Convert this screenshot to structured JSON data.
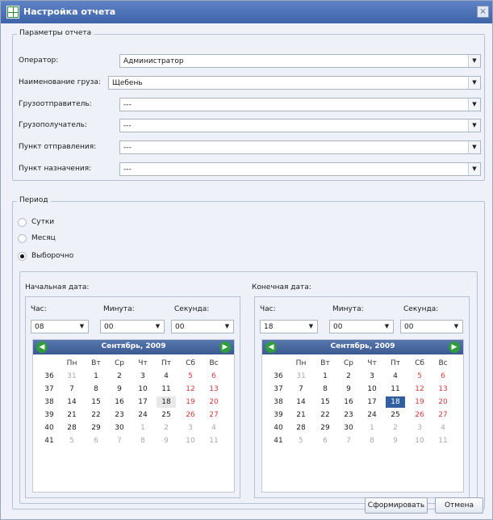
{
  "window": {
    "title": "Настройка отчета",
    "close_glyph": "×"
  },
  "params": {
    "legend": "Параметры отчета",
    "rows": [
      {
        "label": "Оператор:",
        "value": "Администратор"
      },
      {
        "label": "Наименование груза:",
        "value": "Щебень"
      },
      {
        "label": "Грузоотправитель:",
        "value": "---"
      },
      {
        "label": "Грузополучатель:",
        "value": "---"
      },
      {
        "label": "Пункт отправления:",
        "value": "---"
      },
      {
        "label": "Пункт назначения:",
        "value": "---"
      }
    ]
  },
  "period": {
    "legend": "Период",
    "options": [
      {
        "label": "Сутки",
        "checked": false
      },
      {
        "label": "Месяц",
        "checked": false
      },
      {
        "label": "Выборочно",
        "checked": true
      }
    ]
  },
  "dates": {
    "start": {
      "label": "Начальная дата:",
      "hour_label": "Час:",
      "minute_label": "Минута:",
      "second_label": "Секунда:",
      "hour": "08",
      "minute": "00",
      "second": "00",
      "calendar": {
        "title": "Сентябрь, 2009",
        "prev": "◀",
        "next": "▶",
        "highlight_day": "18",
        "highlight_style": "today"
      }
    },
    "end": {
      "label": "Конечная дата:",
      "hour_label": "Час:",
      "minute_label": "Минута:",
      "second_label": "Секунда:",
      "hour": "18",
      "minute": "00",
      "second": "00",
      "calendar": {
        "title": "Сентябрь, 2009",
        "prev": "◀",
        "next": "▶",
        "highlight_day": "18",
        "highlight_style": "selected"
      }
    },
    "weekdays": [
      "Пн",
      "Вт",
      "Ср",
      "Чт",
      "Пт",
      "Сб",
      "Вс"
    ],
    "weeks": [
      {
        "num": "36",
        "days": [
          "31",
          "1",
          "2",
          "3",
          "4",
          "5",
          "6"
        ]
      },
      {
        "num": "37",
        "days": [
          "7",
          "8",
          "9",
          "10",
          "11",
          "12",
          "13"
        ]
      },
      {
        "num": "38",
        "days": [
          "14",
          "15",
          "16",
          "17",
          "18",
          "19",
          "20"
        ]
      },
      {
        "num": "39",
        "days": [
          "21",
          "22",
          "23",
          "24",
          "25",
          "26",
          "27"
        ]
      },
      {
        "num": "40",
        "days": [
          "28",
          "29",
          "30",
          "1",
          "2",
          "3",
          "4"
        ]
      },
      {
        "num": "41",
        "days": [
          "5",
          "6",
          "7",
          "8",
          "9",
          "10",
          "11"
        ]
      }
    ],
    "muted_cells": {
      "36": [
        0
      ],
      "40": [
        3,
        4,
        5,
        6
      ],
      "41": [
        0,
        1,
        2,
        3,
        4,
        5,
        6
      ]
    }
  },
  "buttons": {
    "generate": "Сформировать",
    "cancel": "Отмена"
  },
  "colors": {
    "accent": "#3d63aa",
    "weekend": "#d63a3a",
    "selected": "#315f9f",
    "nav": "#2f9d3a"
  },
  "icons": {
    "app": "report-settings-icon",
    "dropdown": "chevron-down-icon",
    "prev": "arrow-left-icon",
    "next": "arrow-right-icon"
  }
}
